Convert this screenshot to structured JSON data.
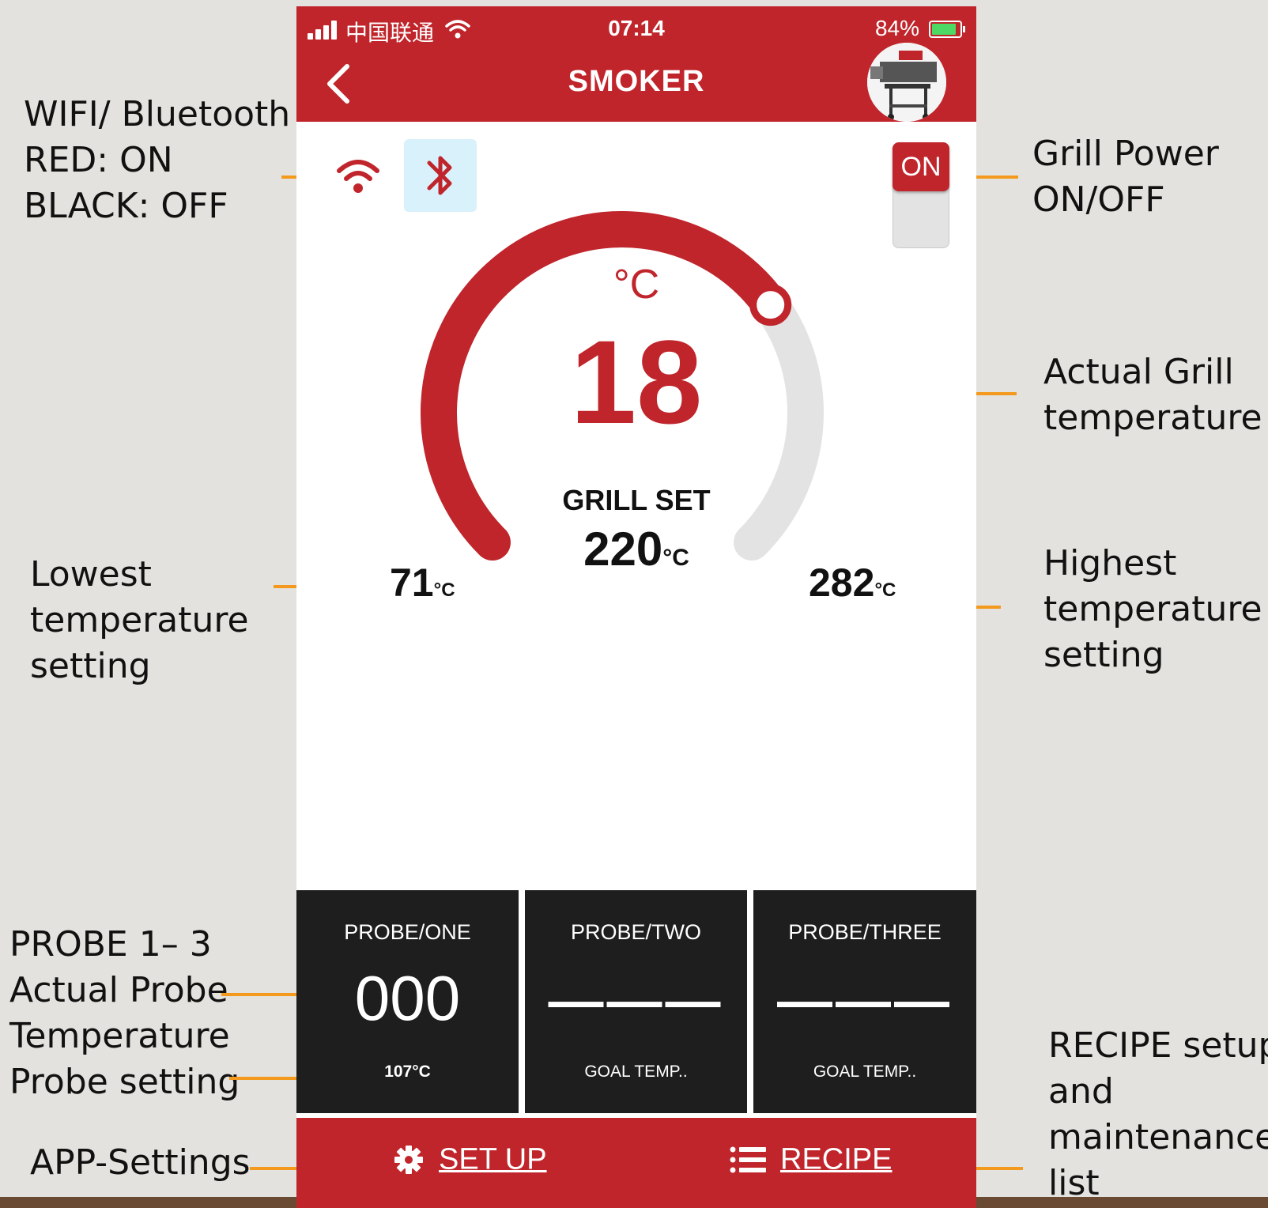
{
  "status_bar": {
    "carrier": "中国联通",
    "time": "07:14",
    "battery_percent": "84%"
  },
  "header": {
    "title": "SMOKER"
  },
  "power": {
    "label": "ON"
  },
  "gauge": {
    "unit": "°C",
    "actual_temp": "18",
    "set_label": "GRILL SET",
    "set_value": "220",
    "min_value": "71",
    "max_value": "282",
    "value_unit": "°C",
    "accent_color": "#c0252b",
    "set_fraction": 0.7
  },
  "probes": [
    {
      "name": "PROBE/ONE",
      "value": "000",
      "goal": "107°C"
    },
    {
      "name": "PROBE/TWO",
      "value": "———",
      "goal": "GOAL TEMP.."
    },
    {
      "name": "PROBE/THREE",
      "value": "———",
      "goal": "GOAL TEMP.."
    }
  ],
  "bottom_bar": {
    "setup_label": "SET UP",
    "recipe_label": "RECIPE"
  },
  "annotations": {
    "wifi_bt": [
      "WIFI/ Bluetooth",
      "RED: ON",
      "BLACK: OFF"
    ],
    "power": [
      "Grill Power",
      "ON/OFF"
    ],
    "actual": [
      "Actual Grill",
      "temperature"
    ],
    "lowest": [
      "Lowest",
      "temperature",
      "setting"
    ],
    "highest": [
      "Highest",
      "temperature",
      "setting"
    ],
    "probe": [
      "PROBE 1– 3",
      "Actual Probe",
      "Temperature",
      "Probe setting"
    ],
    "app_settings": [
      "APP-Settings"
    ],
    "recipe": [
      "RECIPE setup",
      "and",
      "maintenance",
      "list"
    ]
  }
}
